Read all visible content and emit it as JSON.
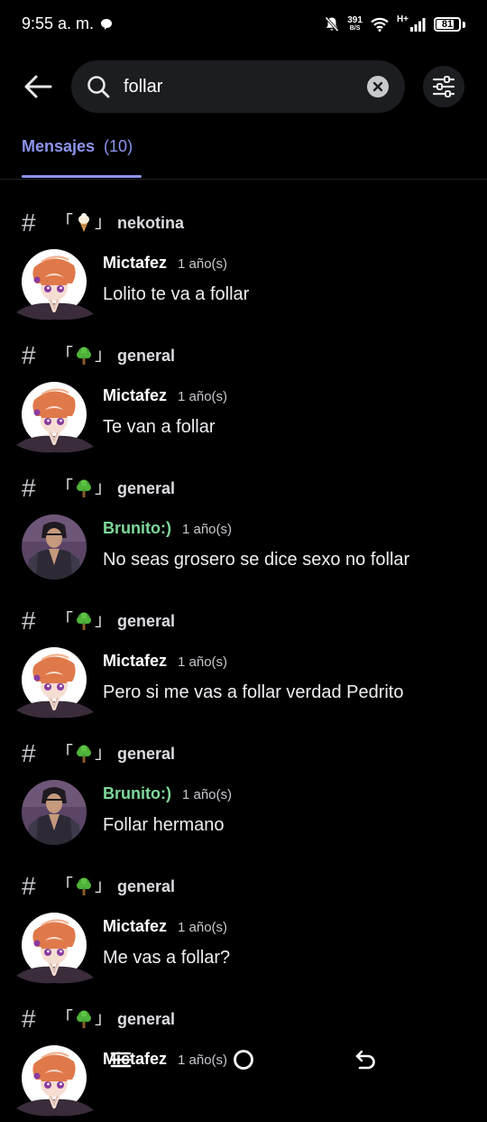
{
  "status_bar": {
    "time": "9:55 a. m.",
    "net_speed_value": "391",
    "net_speed_unit": "B/S",
    "network_type": "H+",
    "battery_level": "81"
  },
  "search": {
    "query": "follar"
  },
  "tab": {
    "label": "Mensajes",
    "count": "(10)"
  },
  "results": [
    {
      "channel_open": "「",
      "channel_emoji": "ice-cream-icon",
      "channel_close": "」",
      "channel_name": "nekotina",
      "author": "Mictafez",
      "author_color": "#ffffff",
      "avatar": "anime-girl-avatar",
      "timestamp": "1 año(s)",
      "message": "Lolito te va a follar"
    },
    {
      "channel_open": "「",
      "channel_emoji": "tree-icon",
      "channel_close": "」",
      "channel_name": "general",
      "author": "Mictafez",
      "author_color": "#ffffff",
      "avatar": "anime-girl-avatar",
      "timestamp": "1 año(s)",
      "message": "Te van a follar"
    },
    {
      "channel_open": "「",
      "channel_emoji": "tree-icon",
      "channel_close": "」",
      "channel_name": "general",
      "author": "Brunito:)",
      "author_color": "#7fd99a",
      "avatar": "fighter-avatar",
      "timestamp": "1 año(s)",
      "message": "No seas grosero se dice sexo no follar"
    },
    {
      "channel_open": "「",
      "channel_emoji": "tree-icon",
      "channel_close": "」",
      "channel_name": "general",
      "author": "Mictafez",
      "author_color": "#ffffff",
      "avatar": "anime-girl-avatar",
      "timestamp": "1 año(s)",
      "message": "Pero si me vas a follar verdad Pedrito"
    },
    {
      "channel_open": "「",
      "channel_emoji": "tree-icon",
      "channel_close": "」",
      "channel_name": "general",
      "author": "Brunito:)",
      "author_color": "#7fd99a",
      "avatar": "fighter-avatar",
      "timestamp": "1 año(s)",
      "message": "Follar hermano"
    },
    {
      "channel_open": "「",
      "channel_emoji": "tree-icon",
      "channel_close": "」",
      "channel_name": "general",
      "author": "Mictafez",
      "author_color": "#ffffff",
      "avatar": "anime-girl-avatar",
      "timestamp": "1 año(s)",
      "message": "Me vas a follar?"
    },
    {
      "channel_open": "「",
      "channel_emoji": "tree-icon",
      "channel_close": "」",
      "channel_name": "general",
      "author": "Mictafez",
      "author_color": "#ffffff",
      "avatar": "anime-girl-avatar",
      "timestamp": "1 año(s)",
      "message": ""
    }
  ],
  "colors": {
    "accent": "#8c94ee",
    "background": "#000000",
    "search_background": "#1c1d21"
  },
  "nav_icons": [
    "menu-icon",
    "home-circle-icon",
    "back-arrow-icon"
  ]
}
